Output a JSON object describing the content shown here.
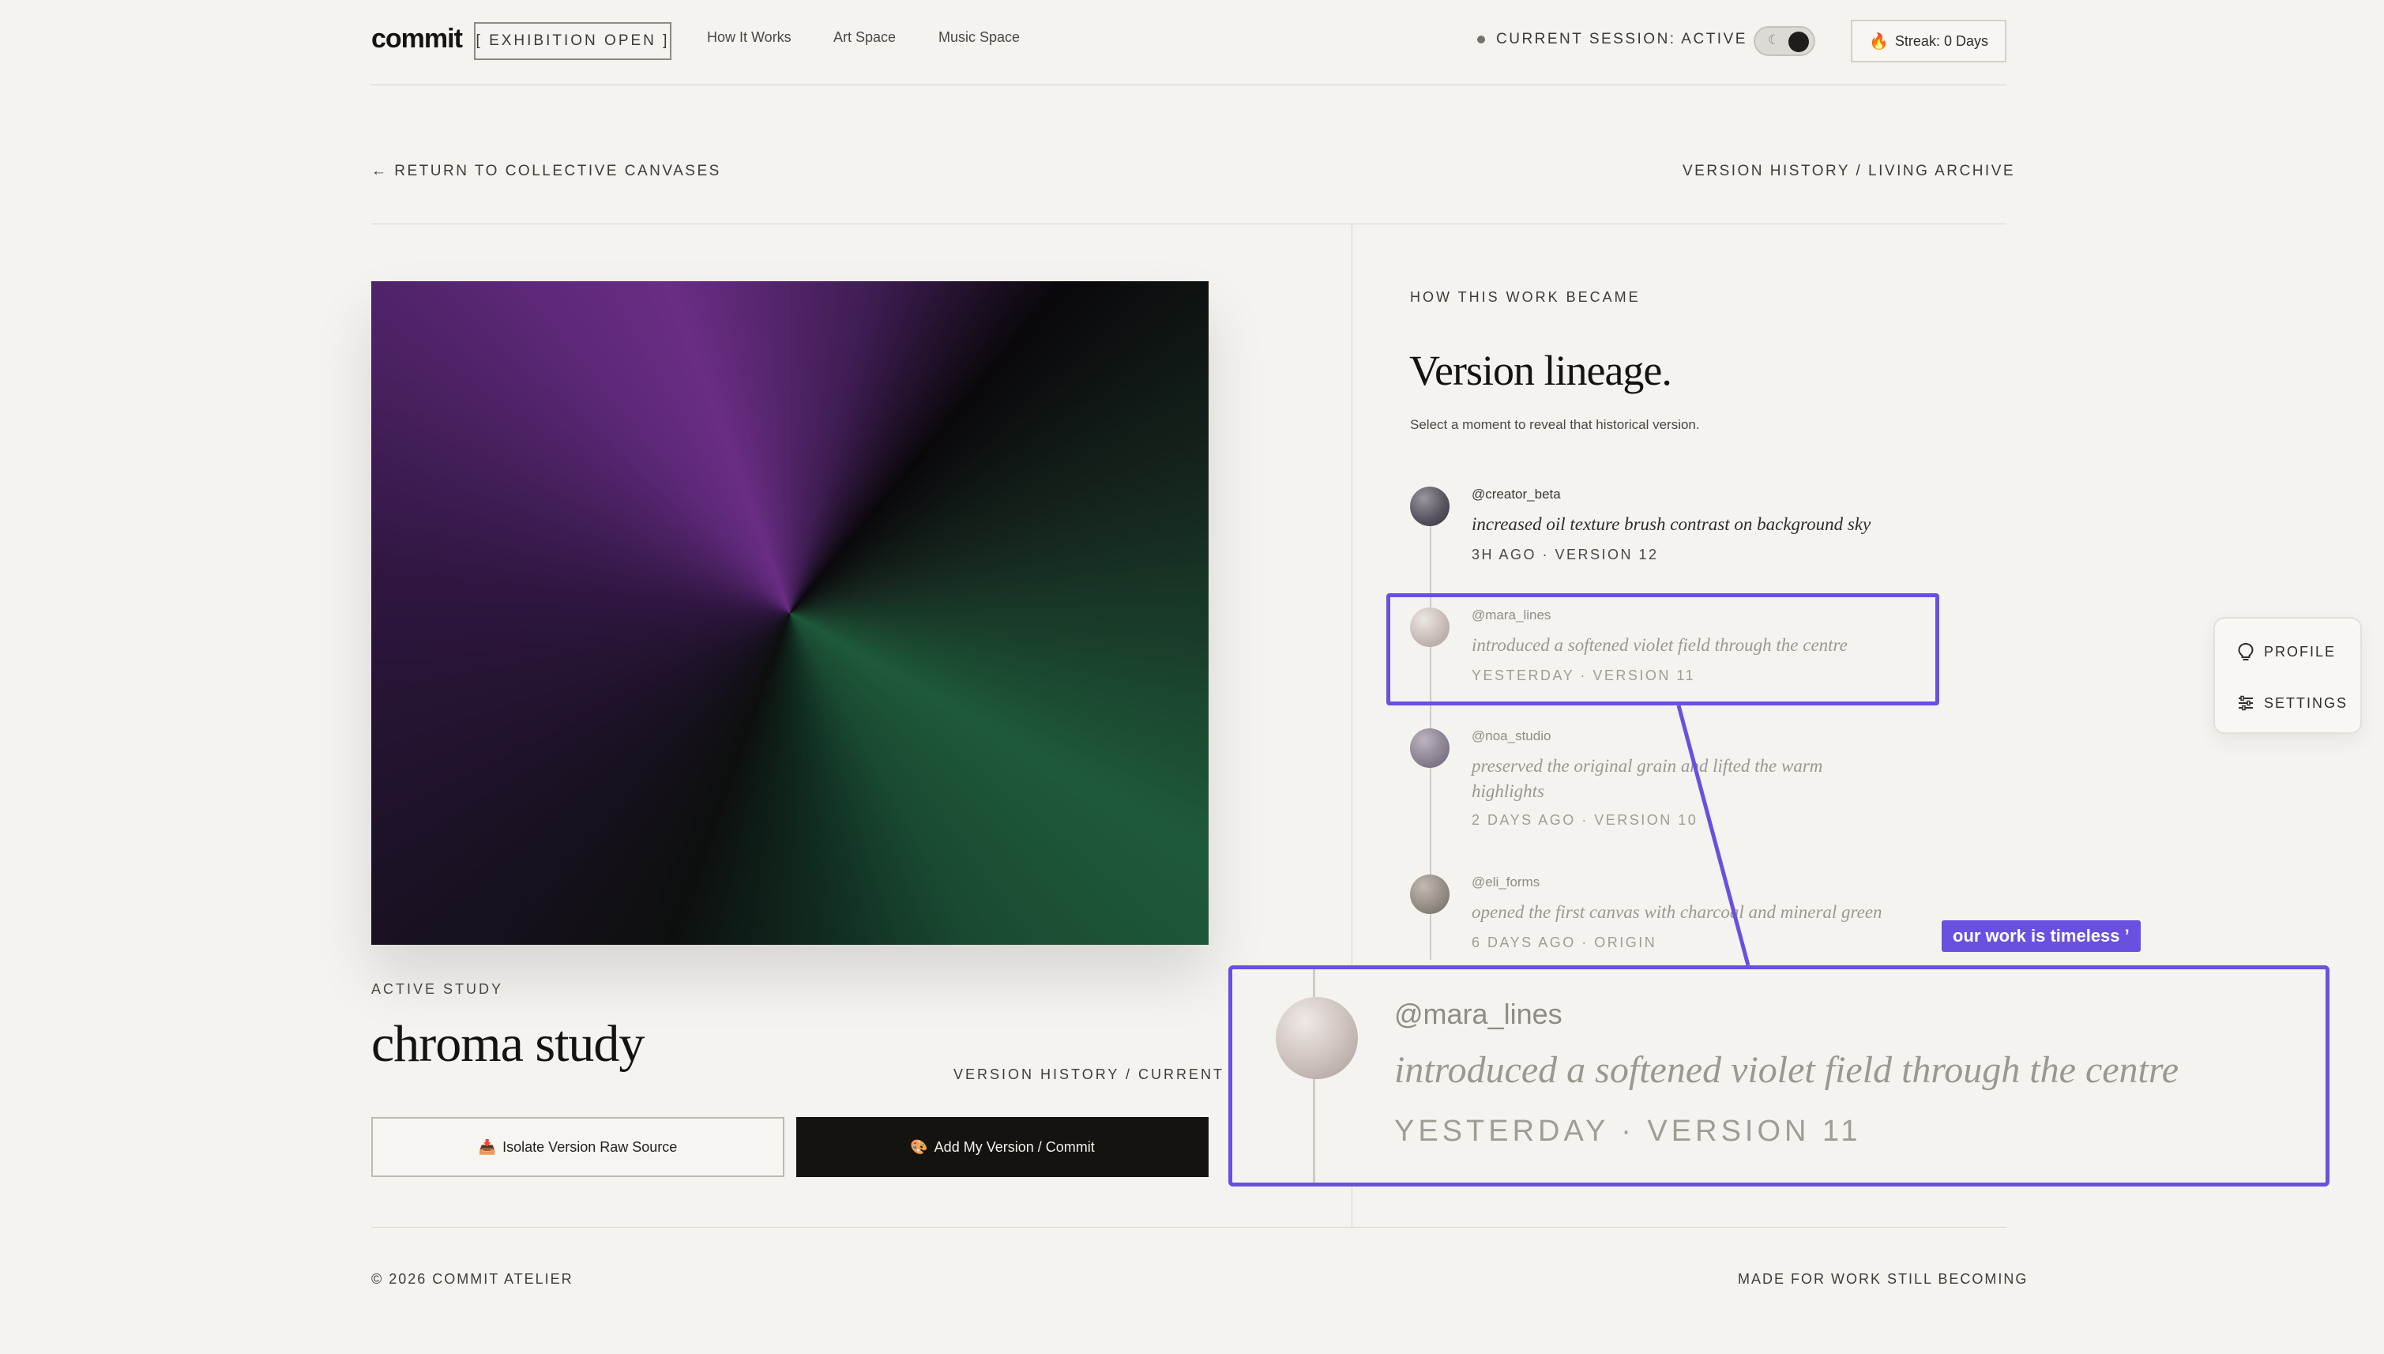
{
  "header": {
    "logo": "commit",
    "exhibition_badge": "[ EXHIBITION OPEN ]",
    "nav": [
      {
        "label": "How It Works"
      },
      {
        "label": "Art Space"
      },
      {
        "label": "Music Space"
      }
    ],
    "session_status": "CURRENT SESSION: ACTIVE",
    "streak": "Streak: 0 Days"
  },
  "subheader": {
    "back_link": "← RETURN TO COLLECTIVE CANVASES",
    "archive_label": "VERSION HISTORY / LIVING ARCHIVE"
  },
  "artwork": {
    "active_label": "ACTIVE STUDY",
    "title": "chroma study",
    "version_label": "VERSION HISTORY / CURRENT",
    "isolate_button": "Isolate Version Raw Source",
    "commit_button": "Add My Version / Commit",
    "colors": {
      "green": "#1e5a3a",
      "violet": "#6a2d84",
      "dark": "#0d0f0e"
    }
  },
  "lineage": {
    "eyebrow": "HOW THIS WORK BECAME",
    "title": "Version lineage.",
    "subtitle": "Select a moment to reveal that historical version.",
    "entries": [
      {
        "handle": "@creator_beta",
        "description": "increased oil texture brush contrast on background sky",
        "meta": "3H AGO · VERSION 12"
      },
      {
        "handle": "@mara_lines",
        "description": "introduced a softened violet field through the centre",
        "meta": "YESTERDAY · VERSION 11"
      },
      {
        "handle": "@noa_studio",
        "description": "preserved the original grain and lifted the warm highlights",
        "meta": "2 DAYS AGO · VERSION 10"
      },
      {
        "handle": "@eli_forms",
        "description": "opened the first canvas with charcoal and mineral green",
        "meta": "6 DAYS AGO · ORIGIN"
      }
    ]
  },
  "annotation": {
    "caption": "our work is timeless ’",
    "zoom_handle": "@mara_lines",
    "zoom_description": "introduced a softened violet field through the centre",
    "zoom_meta": "YESTERDAY · VERSION 11",
    "accent": "#6b4fe0"
  },
  "floating_menu": {
    "profile": "PROFILE",
    "settings": "SETTINGS"
  },
  "footer": {
    "copyright": "© 2026 COMMIT ATELIER",
    "tagline": "MADE FOR WORK STILL BECOMING"
  }
}
